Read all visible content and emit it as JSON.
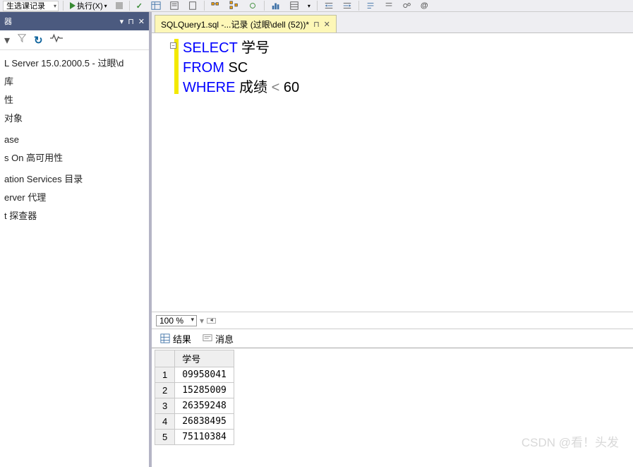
{
  "toolbar": {
    "db_combo": "生选课记录",
    "execute_label": "执行(X)"
  },
  "sidebar": {
    "server_label": "L Server 15.0.2000.5 - 过眼\\d",
    "items": [
      "库",
      "性",
      "对象",
      "",
      "ase",
      "s On 高可用性",
      "",
      "ation Services 目录",
      "erver 代理",
      "t 探查器"
    ]
  },
  "tab": {
    "title": "SQLQuery1.sql -...记录 (过眼\\dell (52))*"
  },
  "code": {
    "l1_kw": "SELECT",
    "l1_t": " 学号",
    "l2_kw": "FROM",
    "l2_t": " SC",
    "l3_kw": "WHERE",
    "l3_t1": " 成绩 ",
    "l3_op": "<",
    "l3_t2": " 60"
  },
  "zoom": {
    "value": "100 %"
  },
  "result_tabs": {
    "results": "结果",
    "messages": "消息"
  },
  "grid": {
    "header": "学号",
    "rows": [
      {
        "n": "1",
        "v": "09958041"
      },
      {
        "n": "2",
        "v": "15285009"
      },
      {
        "n": "3",
        "v": "26359248"
      },
      {
        "n": "4",
        "v": "26838495"
      },
      {
        "n": "5",
        "v": "75110384"
      }
    ]
  },
  "watermark": "CSDN @看！头发"
}
